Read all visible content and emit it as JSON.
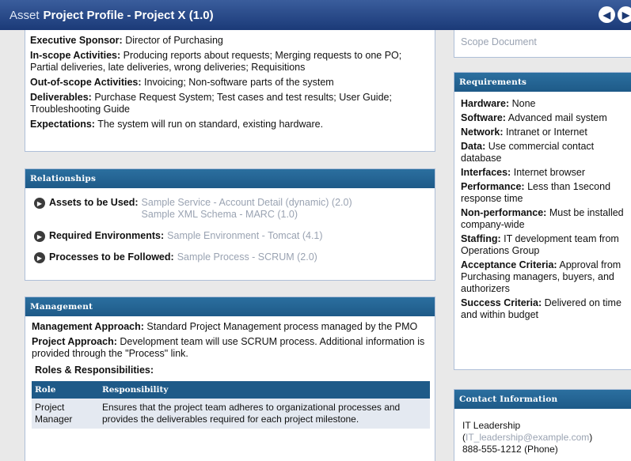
{
  "window": {
    "asset_prefix": "Asset",
    "title": "Project Profile - Project X (1.0)",
    "back_icon": "◀",
    "forward_icon": "▶"
  },
  "scope": {
    "executive_sponsor_label": "Executive Sponsor:",
    "executive_sponsor_value": "Director of Purchasing",
    "in_scope_label": "In-scope Activities:",
    "in_scope_value": "Producing reports about requests; Merging requests to one PO; Partial deliveries, late deliveries, wrong deliveries; Requisitions",
    "out_scope_label": "Out-of-scope Activities:",
    "out_scope_value": "Invoicing; Non-software parts of the system",
    "deliverables_label": "Deliverables:",
    "deliverables_value": "Purchase Request System; Test cases and test results; User Guide; Troubleshooting Guide",
    "expectations_label": "Expectations:",
    "expectations_value": "The system will run on standard, existing hardware."
  },
  "relationships": {
    "header": "Relationships",
    "assets_label": "Assets to be Used:",
    "assets_link_1": "Sample Service - Account Detail (dynamic) (2.0)",
    "assets_link_2": "Sample XML Schema - MARC (1.0)",
    "env_label": "Required Environments:",
    "env_link": "Sample Environment - Tomcat (4.1)",
    "proc_label": "Processes to be Followed:",
    "proc_link": "Sample Process - SCRUM (2.0)"
  },
  "management": {
    "header": "Management",
    "mgmt_approach_label": "Management Approach:",
    "mgmt_approach_value": "Standard Project Management process managed by the PMO",
    "project_approach_label": "Project Approach:",
    "project_approach_value": "Development team will use SCRUM process. Additional information is provided through the \"Process\" link.",
    "roles_heading": "Roles & Responsibilities:",
    "table_headers": {
      "role": "Role",
      "responsibility": "Responsibility"
    },
    "rows": [
      {
        "role": "Project Manager",
        "responsibility": "Ensures that the project team adheres to organizational processes and provides the deliverables required for each project milestone."
      }
    ]
  },
  "right": {
    "scope_document_link": "Scope Document",
    "requirements": {
      "header": "Requirements",
      "hardware_label": "Hardware:",
      "hardware_value": "None",
      "software_label": "Software:",
      "software_value": "Advanced mail system",
      "network_label": "Network:",
      "network_value": "Intranet or Internet",
      "data_label": "Data:",
      "data_value": "Use commercial contact database",
      "interfaces_label": "Interfaces:",
      "interfaces_value": "Internet browser",
      "performance_label": "Performance:",
      "performance_value": "Less than 1second response time",
      "nonperf_label": "Non-performance:",
      "nonperf_value": "Must be installed company-wide",
      "staffing_label": "Staffing:",
      "staffing_value": "IT development team from Operations Group",
      "acceptance_label": "Acceptance Criteria:",
      "acceptance_value": "Approval from Purchasing managers, buyers, and authorizers",
      "success_label": "Success Criteria:",
      "success_value": "Delivered on time and within budget"
    },
    "contact": {
      "header": "Contact Information",
      "name": "IT Leadership",
      "email_open": "(",
      "email": "IT_leadership@example.com",
      "email_close": ")",
      "phone": "888-555-1212 (Phone)"
    }
  }
}
